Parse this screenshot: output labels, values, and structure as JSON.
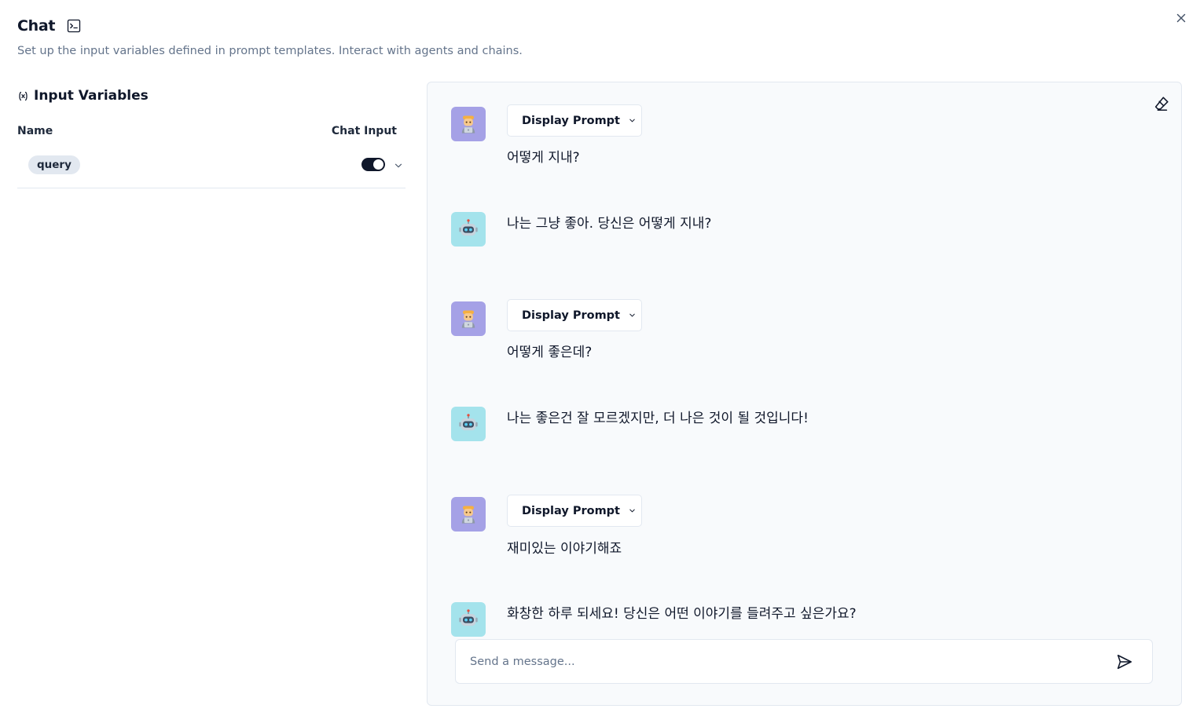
{
  "header": {
    "title": "Chat",
    "subtitle": "Set up the input variables defined in prompt templates. Interact with agents and chains."
  },
  "input_variables": {
    "title": "Input Variables",
    "columns": {
      "name": "Name",
      "chat_input": "Chat Input"
    },
    "rows": [
      {
        "name": "query",
        "chat_input_enabled": true
      }
    ]
  },
  "chat": {
    "display_prompt_label": "Display Prompt",
    "messages": [
      {
        "role": "user",
        "avatar": "technologist-emoji",
        "text": "어떻게 지내?"
      },
      {
        "role": "bot",
        "avatar": "robot-emoji",
        "text": "나는 그냥 좋아. 당신은 어떻게 지내?"
      },
      {
        "role": "user",
        "avatar": "technologist-emoji",
        "text": "어떻게 좋은데?"
      },
      {
        "role": "bot",
        "avatar": "robot-emoji",
        "text": "나는 좋은건 잘 모르겠지만, 더 나은 것이 될 것입니다!"
      },
      {
        "role": "user",
        "avatar": "technologist-emoji",
        "text": "재미있는 이야기해죠"
      },
      {
        "role": "bot",
        "avatar": "robot-emoji",
        "text": "화창한 하루 되세요! 당신은 어떤 이야기를 들려주고 싶은가요?"
      }
    ],
    "input_placeholder": "Send a message..."
  },
  "colors": {
    "user_avatar_bg": "#a5a1e6",
    "bot_avatar_bg": "#a4e3ec",
    "toggle_on": "#0f172a"
  }
}
